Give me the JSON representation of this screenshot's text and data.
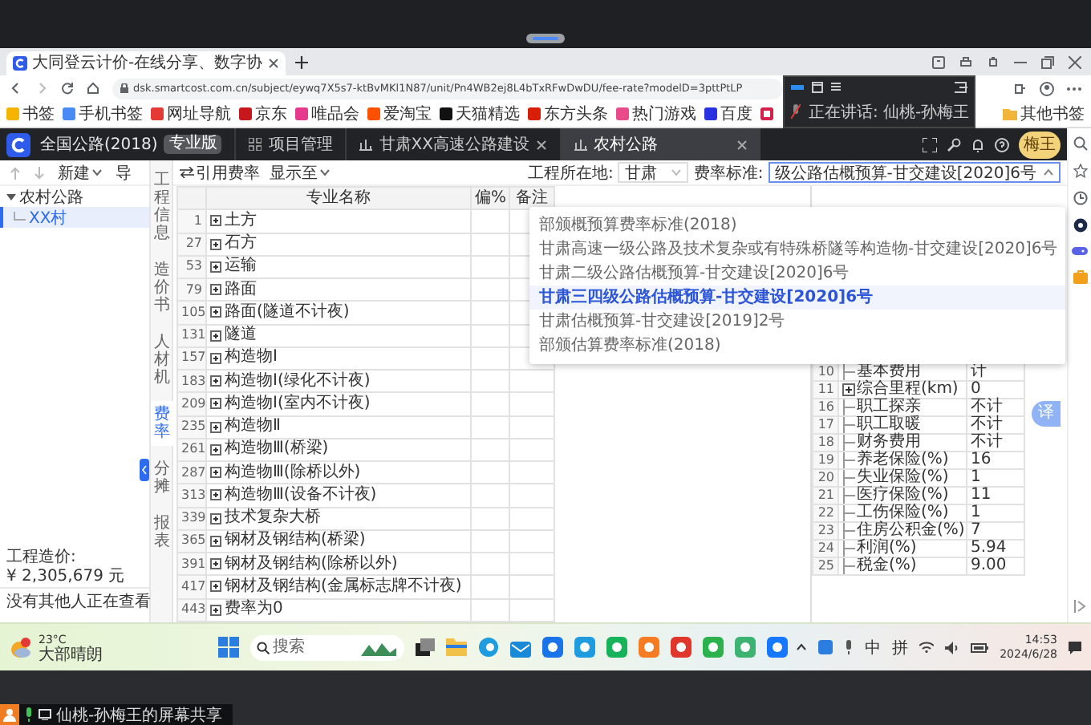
{
  "browser": {
    "tab_title": "大同登云计价-在线分享、数字协",
    "address": "dsk.smartcost.com.cn/subject/eywq7X5s7-ktBvMKl1N87/unit/Pn4WB2ej8L4bTxRFwDwDU/fee-rate?modelD=3pttPtLP",
    "bookmarks": [
      {
        "label": "书签",
        "color": "#f4b400"
      },
      {
        "label": "手机书签",
        "color": "#4a8af4"
      },
      {
        "label": "网址导航",
        "color": "#e53935"
      },
      {
        "label": "京东",
        "color": "#c8161d"
      },
      {
        "label": "唯品会",
        "color": "#e6398d"
      },
      {
        "label": "爱淘宝",
        "color": "#ff5000"
      },
      {
        "label": "天猫精选",
        "color": "#111111"
      },
      {
        "label": "东方头条",
        "color": "#d81e06"
      },
      {
        "label": "热门游戏",
        "color": "#e84a8a"
      },
      {
        "label": "百度",
        "color": "#2932e1"
      }
    ],
    "other_bookmarks": "其他书签"
  },
  "meeting_panel": {
    "speaking": "正在讲话: 仙桃-孙梅王"
  },
  "app": {
    "product": "全国公路(2018)",
    "edition": "专业版",
    "tabs": [
      {
        "label": "项目管理",
        "kind": "grid",
        "selected": false,
        "closable": false
      },
      {
        "label": "甘肃XX高速公路建设",
        "kind": "chart",
        "selected": false,
        "closable": true
      },
      {
        "label": "农村公路",
        "kind": "chart",
        "selected": true,
        "closable": true
      }
    ],
    "avatar": "梅王"
  },
  "sidebar": {
    "new_label": "新建",
    "next_label": "导",
    "tree": [
      {
        "label": "农村公路",
        "expanded": true,
        "selected": false,
        "children": [
          {
            "label": "XX村",
            "selected": true
          }
        ]
      }
    ],
    "cost_label": "工程造价:",
    "cost_value": "¥ 2,305,679 元",
    "viewers": "没有其他人正在查看"
  },
  "vertical_tabs": [
    {
      "label": "工程信息",
      "selected": false
    },
    {
      "label": "造价书",
      "selected": false
    },
    {
      "label": "人材机",
      "selected": false
    },
    {
      "label": "费率",
      "selected": true
    },
    {
      "label": "分摊",
      "selected": false
    },
    {
      "label": "报表",
      "selected": false
    }
  ],
  "toolbar": {
    "quote_rate": "引用费率",
    "show_to": "显示至",
    "location_label": "工程所在地:",
    "location": "甘肃",
    "standard_label": "费率标准:",
    "standard": "级公路估概预算-甘交建设[2020]6号",
    "standard_open": true,
    "options": [
      {
        "label": "部颁概预算费率标准(2018)",
        "selected": false
      },
      {
        "label": "甘肃高速一级公路及技术复杂或有特殊桥隧等构造物-甘交建设[2020]6号",
        "selected": false
      },
      {
        "label": "甘肃二级公路估概预算-甘交建设[2020]6号",
        "selected": false
      },
      {
        "label": "甘肃三四级公路估概预算-甘交建设[2020]6号",
        "selected": true
      },
      {
        "label": "甘肃估概预算-甘交建设[2019]2号",
        "selected": false
      },
      {
        "label": "部颁估算费率标准(2018)",
        "selected": false
      }
    ]
  },
  "fee_table": {
    "columns": [
      "专业名称",
      "偏%",
      "备注"
    ],
    "rows": [
      {
        "no": "1",
        "name": "土方"
      },
      {
        "no": "27",
        "name": "石方"
      },
      {
        "no": "53",
        "name": "运输"
      },
      {
        "no": "79",
        "name": "路面"
      },
      {
        "no": "105",
        "name": "路面(隧道不计夜)"
      },
      {
        "no": "131",
        "name": "隧道"
      },
      {
        "no": "157",
        "name": "构造物Ⅰ"
      },
      {
        "no": "183",
        "name": "构造物Ⅰ(绿化不计夜)"
      },
      {
        "no": "209",
        "name": "构造物Ⅰ(室内不计夜)"
      },
      {
        "no": "235",
        "name": "构造物Ⅱ"
      },
      {
        "no": "261",
        "name": "构造物Ⅲ(桥梁)"
      },
      {
        "no": "287",
        "name": "构造物Ⅲ(除桥以外)"
      },
      {
        "no": "313",
        "name": "构造物Ⅲ(设备不计夜)"
      },
      {
        "no": "339",
        "name": "技术复杂大桥"
      },
      {
        "no": "365",
        "name": "钢材及钢结构(桥梁)"
      },
      {
        "no": "391",
        "name": "钢材及钢结构(除桥以外)"
      },
      {
        "no": "417",
        "name": "钢材及钢结构(金属标志牌不计夜)"
      },
      {
        "no": "443",
        "name": "费率为0"
      }
    ]
  },
  "param_table": {
    "rows": [
      {
        "no": "10",
        "name": "基本费用",
        "value": "计",
        "kind": "leaf"
      },
      {
        "no": "11",
        "name": "综合里程(km)",
        "value": "0",
        "kind": "group"
      },
      {
        "no": "16",
        "name": "职工探亲",
        "value": "不计",
        "kind": "leaf"
      },
      {
        "no": "17",
        "name": "职工取暖",
        "value": "不计",
        "kind": "leaf"
      },
      {
        "no": "18",
        "name": "财务费用",
        "value": "不计",
        "kind": "leaf"
      },
      {
        "no": "19",
        "name": "养老保险(%)",
        "value": "16",
        "kind": "leaf"
      },
      {
        "no": "20",
        "name": "失业保险(%)",
        "value": "1",
        "kind": "leaf"
      },
      {
        "no": "21",
        "name": "医疗保险(%)",
        "value": "11",
        "kind": "leaf"
      },
      {
        "no": "22",
        "name": "工伤保险(%)",
        "value": "1",
        "kind": "leaf"
      },
      {
        "no": "23",
        "name": "住房公积金(%)",
        "value": "7",
        "kind": "leaf"
      },
      {
        "no": "24",
        "name": "利润(%)",
        "value": "5.94",
        "kind": "leaf"
      },
      {
        "no": "25",
        "name": "税金(%)",
        "value": "9.00",
        "kind": "leaf"
      }
    ]
  },
  "translate_badge": "译",
  "taskbar": {
    "temperature": "23°C",
    "weather": "大部晴朗",
    "search_placeholder": "搜索",
    "ime": [
      "中",
      "拼"
    ],
    "time": "14:53",
    "date": "2024/6/28"
  },
  "share_bar": {
    "label": "仙桃-孙梅王的屏幕共享"
  }
}
